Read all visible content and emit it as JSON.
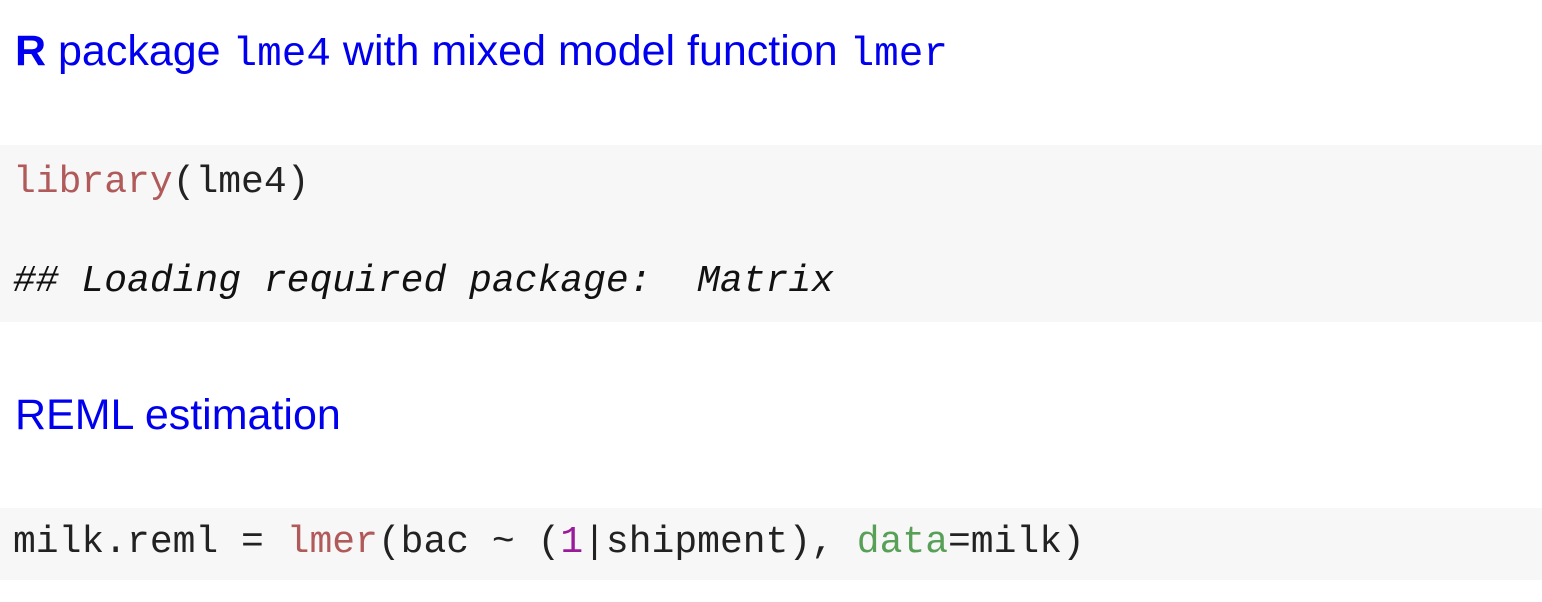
{
  "heading_1": {
    "part_r": "R",
    "part_a": " package ",
    "code_pkg": "lme4",
    "part_b": " with mixed model function ",
    "code_fn": "lmer"
  },
  "code_block_1": {
    "call_fn": "library",
    "call_args": "(lme4)",
    "output": "## Loading required package:  Matrix"
  },
  "heading_2": {
    "text": "REML estimation"
  },
  "code_block_2": {
    "assign": "milk.reml = ",
    "fn": "lmer",
    "open": "(bac ~ (",
    "num": "1",
    "mid": "|shipment), ",
    "arg": "data",
    "close": "=milk)"
  },
  "colors": {
    "heading": "#0000ee",
    "code_background": "#f7f7f7",
    "function": "#b05a5a",
    "number": "#9a1b9a",
    "argument": "#58a058"
  }
}
